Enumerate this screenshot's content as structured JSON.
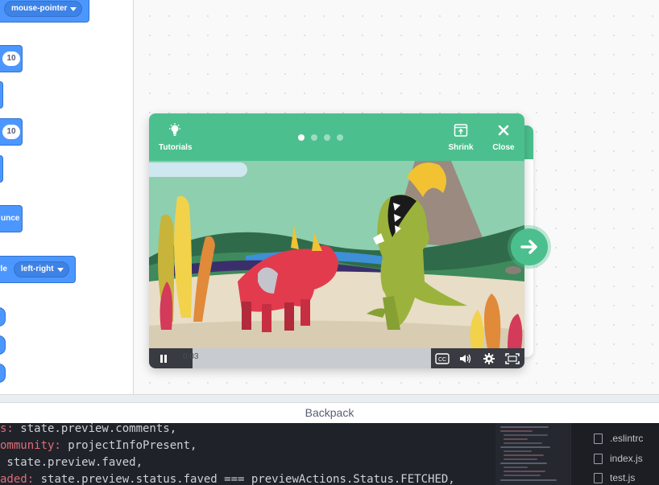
{
  "palette": {
    "mouse_pointer_menu": "mouse-pointer",
    "input_1": "10",
    "input_2": "10",
    "bounce_fragment": "unce",
    "rotation_style_fragment": "yle",
    "rotation_style_value": "left-right"
  },
  "tutorial": {
    "tutorials_label": "Tutorials",
    "shrink_label": "Shrink",
    "close_label": "Close",
    "page_dots": 4,
    "active_page": 1,
    "video_time": "0:03",
    "accent_color": "#4cbf8e"
  },
  "backpack": {
    "label": "Backpack"
  },
  "editor": {
    "lines": [
      {
        "prefix": "s:",
        "code": " state.preview.comments,"
      },
      {
        "prefix": "ommunity:",
        "code": " projectInfoPresent,"
      },
      {
        "prefix": "",
        "code": " state.preview.faved,"
      },
      {
        "prefix": "aded:",
        "code": " state.preview.status.faved === previewActions.Status.FETCHED,"
      }
    ],
    "files": [
      ".eslintrc",
      "index.js",
      "test.js"
    ]
  }
}
